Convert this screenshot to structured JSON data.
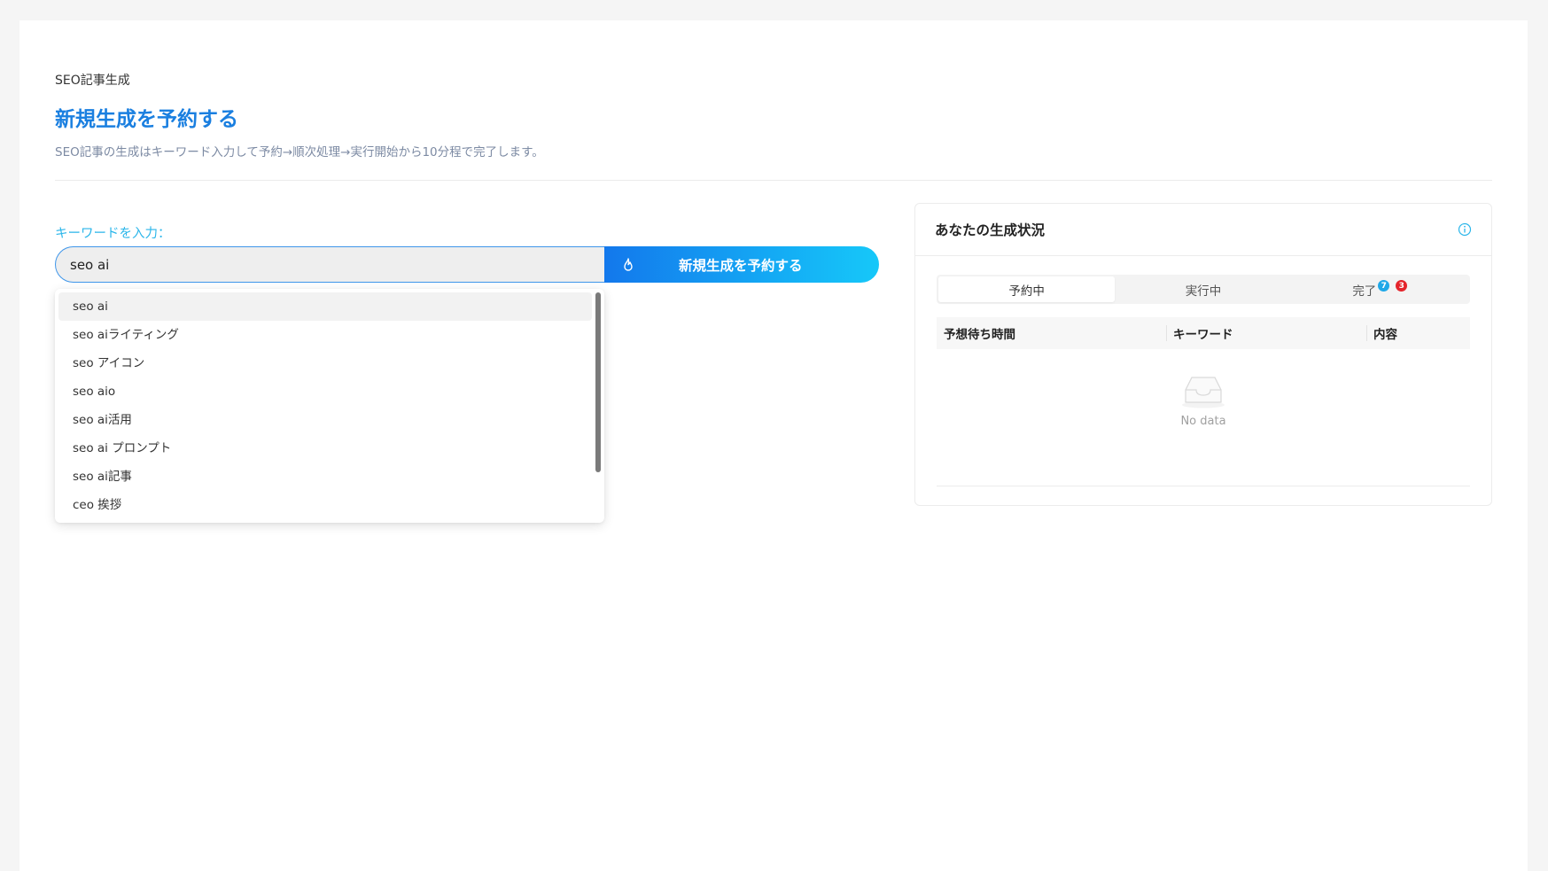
{
  "breadcrumb": "SEO記事生成",
  "header": {
    "title": "新規生成を予約する",
    "subtitle": "SEO記事の生成はキーワード入力して予約→順次処理→実行開始から10分程で完了します。"
  },
  "form": {
    "keyword_label": "キーワードを入力：",
    "keyword_value": "seo ai",
    "submit_label": "新規生成を予約する",
    "submit_icon": "fire-icon"
  },
  "suggestions": [
    "seo ai",
    "seo aiライティング",
    "seo アイコン",
    "seo aio",
    "seo ai活用",
    "seo ai プロンプト",
    "seo ai記事",
    "ceo 挨拶"
  ],
  "status_panel": {
    "title": "あなたの生成状況",
    "info_icon": "info-icon",
    "tabs": [
      {
        "label": "予約中"
      },
      {
        "label": "実行中"
      },
      {
        "label": "完了",
        "badge_primary": "7",
        "badge_secondary": "3"
      }
    ],
    "columns": [
      "予想待ち時間",
      "キーワード",
      "内容"
    ],
    "empty_text": "No data"
  },
  "colors": {
    "accent": "#1a7fe0",
    "label": "#2bb6ea",
    "badge_blue": "#1fa8e8",
    "badge_red": "#e4242b"
  }
}
